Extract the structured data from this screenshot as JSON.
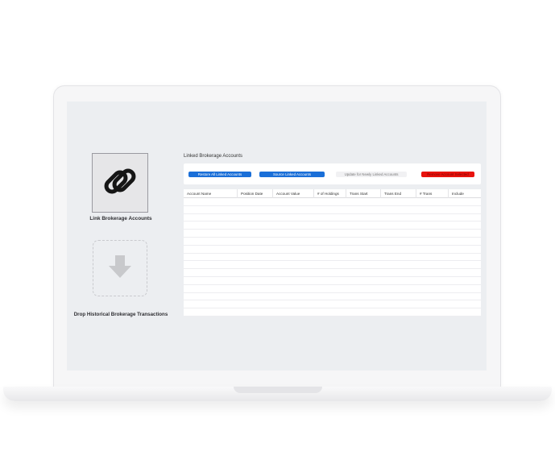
{
  "left_panel": {
    "link_label": "Link Brokerage Accounts",
    "drop_label": "Drop Historical Brokerage Transactions",
    "link_icon": "chain-link-icon",
    "drop_icon": "arrow-down-icon"
  },
  "main": {
    "section_title": "Linked Brokerage Accounts",
    "buttons": {
      "restore": "Restore All Linked Accounts",
      "source": "Source Linked Accounts",
      "update": "Update for Newly Linked Accounts",
      "remove": "Remove Account Selected"
    },
    "table": {
      "columns": [
        "Account Name",
        "Position Date",
        "Account Value",
        "# of Holdings",
        "Trans Start",
        "Trans End",
        "# Trans",
        "Include"
      ],
      "rows": []
    }
  },
  "colors": {
    "primary_button": "#1a6fd8",
    "danger_button": "#e8130d",
    "screen_background": "#eceef1"
  }
}
